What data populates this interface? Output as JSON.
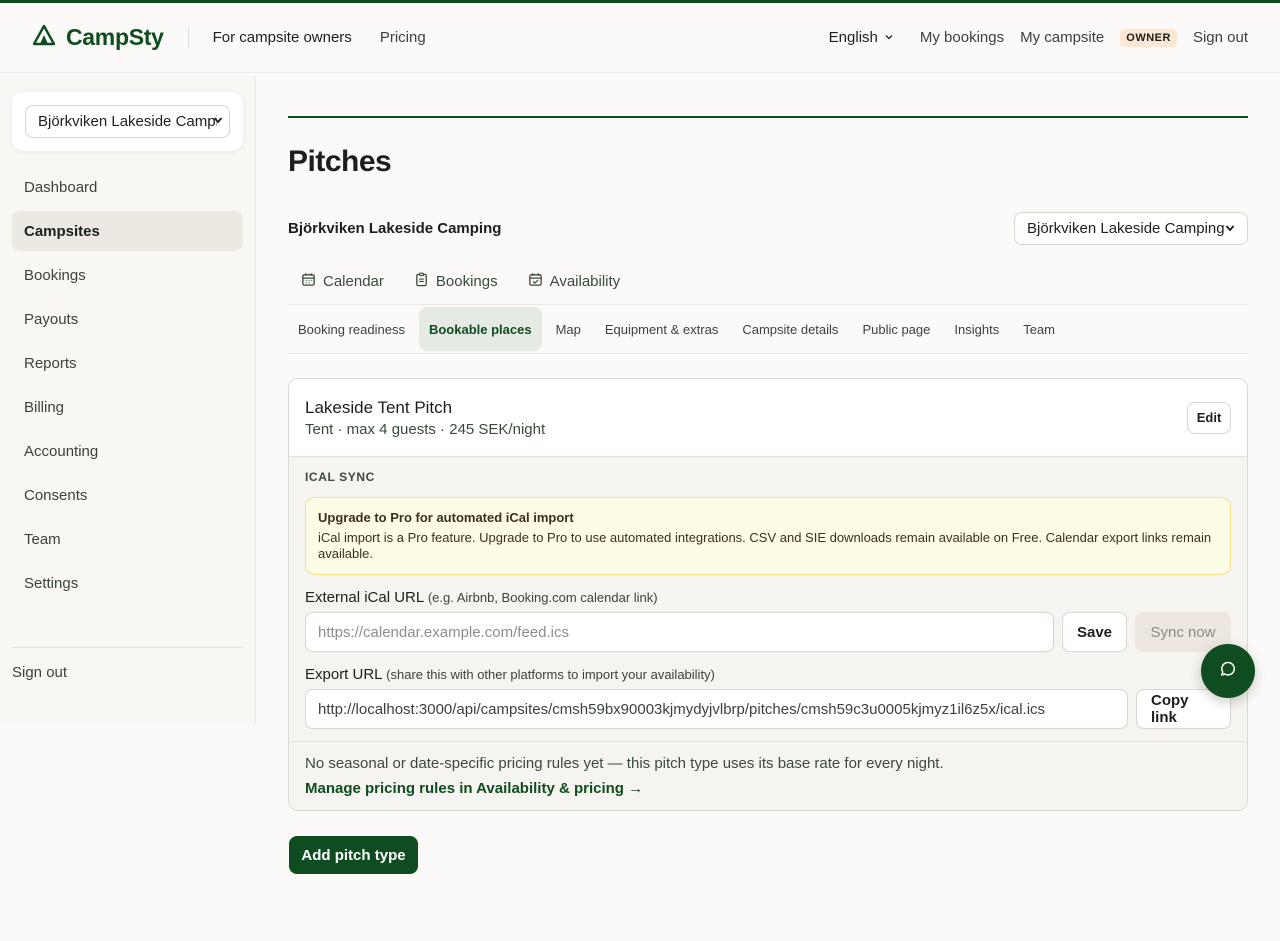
{
  "header": {
    "brand": "CampSty",
    "nav": {
      "owners": "For campsite owners",
      "pricing": "Pricing"
    },
    "language": "English",
    "my_bookings": "My bookings",
    "my_campsite": "My campsite",
    "role_badge": "OWNER",
    "sign_out": "Sign out"
  },
  "sidebar": {
    "campsite_selector": "Björkviken Lakeside Camping",
    "items": [
      {
        "label": "Dashboard"
      },
      {
        "label": "Campsites"
      },
      {
        "label": "Bookings"
      },
      {
        "label": "Payouts"
      },
      {
        "label": "Reports"
      },
      {
        "label": "Billing"
      },
      {
        "label": "Accounting"
      },
      {
        "label": "Consents"
      },
      {
        "label": "Team"
      },
      {
        "label": "Settings"
      }
    ],
    "active_item": "Campsites",
    "sign_out": "Sign out"
  },
  "main": {
    "title": "Pitches",
    "campsite_name": "Björkviken Lakeside Camping",
    "campsite_select": "Björkviken Lakeside Camping",
    "primary_tabs": [
      {
        "label": "Calendar",
        "icon": "calendar-icon"
      },
      {
        "label": "Bookings",
        "icon": "clipboard-icon"
      },
      {
        "label": "Availability",
        "icon": "calendar-check-icon"
      }
    ],
    "sub_tabs": [
      {
        "label": "Booking readiness"
      },
      {
        "label": "Bookable places"
      },
      {
        "label": "Map"
      },
      {
        "label": "Equipment & extras"
      },
      {
        "label": "Campsite details"
      },
      {
        "label": "Public page"
      },
      {
        "label": "Insights"
      },
      {
        "label": "Team"
      }
    ],
    "active_sub_tab": "Bookable places",
    "pitch": {
      "name": "Lakeside Tent Pitch",
      "meta": "Tent · max 4 guests · 245 SEK/night",
      "edit_label": "Edit",
      "ical": {
        "section_label": "ICAL SYNC",
        "upgrade_title": "Upgrade to Pro for automated iCal import",
        "upgrade_text": "iCal import is a Pro feature. Upgrade to Pro to use automated integrations. CSV and SIE downloads remain available on Free. Calendar export links remain available.",
        "external_label": "External iCal URL",
        "external_hint": "(e.g. Airbnb, Booking.com calendar link)",
        "external_placeholder": "https://calendar.example.com/feed.ics",
        "save_label": "Save",
        "sync_label": "Sync now",
        "export_label": "Export URL",
        "export_hint": "(share this with other platforms to import your availability)",
        "export_value": "http://localhost:3000/api/campsites/cmsh59bx90003kjmydyjvlbrp/pitches/cmsh59c3u0005kjmyz1il6z5x/ical.ics",
        "copy_label": "Copy link"
      },
      "pricing_note": "No seasonal or date-specific pricing rules yet — this pitch type uses its base rate for every night.",
      "pricing_link": "Manage pricing rules in Availability & pricing →"
    },
    "add_button": "Add pitch type"
  },
  "colors": {
    "brand": "#0f4c1f",
    "badge": "#fbe7d4",
    "upgrade_bg": "#fefbe6"
  }
}
